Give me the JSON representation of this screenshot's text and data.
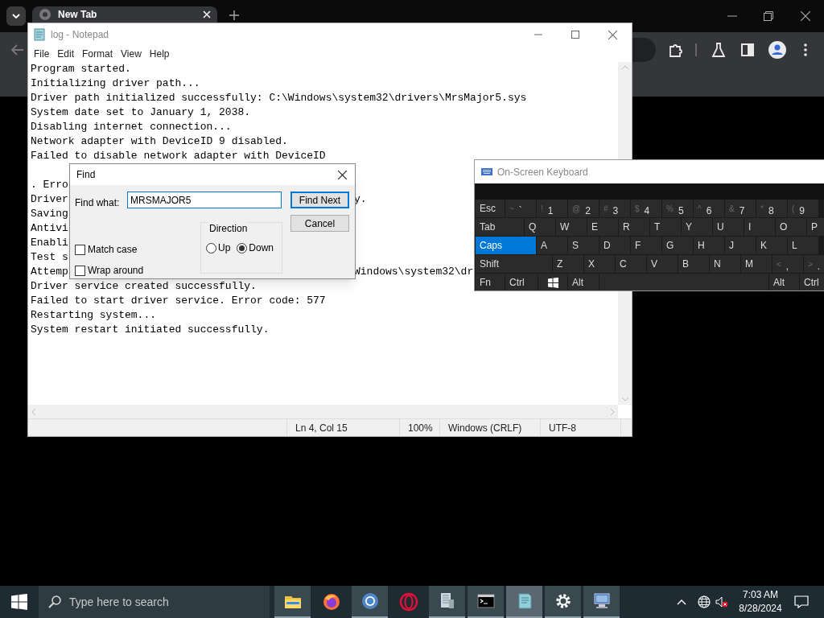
{
  "browser": {
    "tab": {
      "title": "New Tab",
      "selected": true
    }
  },
  "notepad": {
    "title": "log - Notepad",
    "menu": [
      "File",
      "Edit",
      "Format",
      "View",
      "Help"
    ],
    "lines": [
      {
        "text": "Program started."
      },
      {
        "text": "Initializing driver path..."
      },
      {
        "text": "Driver path initialized successfully: C:\\Windows\\system32\\drivers\\MrsMajor5.sys"
      },
      {
        "text": "System date set to January 1, 2038."
      },
      {
        "text": "Disabling internet connection..."
      },
      {
        "text": "Network adapter with DeviceID 9 disabled."
      },
      {
        "text": "Failed to disable network adapter with DeviceID"
      },
      {
        "left": ". Erro",
        "kind": "after_blank_line"
      },
      {
        "left": "Driver",
        "right": "y."
      },
      {
        "left": "Saving"
      },
      {
        "left": "Antivi"
      },
      {
        "left": "Enabli"
      },
      {
        "left": "Test s"
      },
      {
        "left": "Attemp",
        "right": "Windows\\system32\\dr"
      },
      {
        "text": "Driver service created successfully."
      },
      {
        "text": "Failed to start driver service. Error code: 577"
      },
      {
        "text": "Restarting system..."
      },
      {
        "text": "System restart initiated successfully."
      }
    ],
    "status_bar": [
      "Ln 4, Col 15",
      "100%",
      "Windows (CRLF)",
      "UTF-8"
    ]
  },
  "find_dialog": {
    "title": "Find",
    "label": "Find what:",
    "value": "MRSMAJOR5",
    "buttons": [
      {
        "label": "Find Next",
        "default": true
      },
      {
        "label": "Cancel",
        "default": false
      }
    ],
    "direction": {
      "label": "Direction",
      "options": [
        {
          "label": "Up",
          "selected": false
        },
        {
          "label": "Down",
          "selected": true
        }
      ]
    },
    "checkboxes": [
      {
        "label": "Match case",
        "checked": false
      },
      {
        "label": "Wrap around",
        "checked": false
      }
    ]
  },
  "keyboard": {
    "title": "On-Screen Keyboard",
    "rows": [
      [
        {
          "label": "Esc",
          "kind": "mod"
        },
        {
          "label": "`",
          "shift": "~",
          "kind": "key"
        },
        {
          "label": "1",
          "shift": "!",
          "kind": "key"
        },
        {
          "label": "2",
          "shift": "@",
          "kind": "key"
        },
        {
          "label": "3",
          "shift": "#",
          "kind": "key"
        },
        {
          "label": "4",
          "shift": "$",
          "kind": "key"
        },
        {
          "label": "5",
          "shift": "%",
          "kind": "key"
        },
        {
          "label": "6",
          "shift": "^",
          "kind": "key"
        },
        {
          "label": "7",
          "shift": "&",
          "kind": "key"
        },
        {
          "label": "8",
          "shift": "*",
          "kind": "key"
        },
        {
          "label": "9",
          "shift": "(",
          "kind": "key"
        }
      ],
      [
        {
          "label": "Tab",
          "kind": "mod"
        },
        {
          "label": "Q",
          "kind": "key"
        },
        {
          "label": "W",
          "kind": "key"
        },
        {
          "label": "E",
          "kind": "key"
        },
        {
          "label": "R",
          "kind": "key"
        },
        {
          "label": "T",
          "kind": "key"
        },
        {
          "label": "Y",
          "kind": "key"
        },
        {
          "label": "U",
          "kind": "key"
        },
        {
          "label": "I",
          "kind": "key"
        },
        {
          "label": "O",
          "kind": "key"
        },
        {
          "label": "P",
          "kind": "key"
        }
      ],
      [
        {
          "label": "Caps",
          "kind": "mod",
          "selected": true
        },
        {
          "label": "A",
          "kind": "key"
        },
        {
          "label": "S",
          "kind": "key"
        },
        {
          "label": "D",
          "kind": "key"
        },
        {
          "label": "F",
          "kind": "key"
        },
        {
          "label": "G",
          "kind": "key"
        },
        {
          "label": "H",
          "kind": "key"
        },
        {
          "label": "J",
          "kind": "key"
        },
        {
          "label": "K",
          "kind": "key"
        },
        {
          "label": "L",
          "kind": "key"
        }
      ],
      [
        {
          "label": "Shift",
          "kind": "mod"
        },
        {
          "label": "Z",
          "kind": "key"
        },
        {
          "label": "X",
          "kind": "key"
        },
        {
          "label": "C",
          "kind": "key"
        },
        {
          "label": "V",
          "kind": "key"
        },
        {
          "label": "B",
          "kind": "key"
        },
        {
          "label": "N",
          "kind": "key"
        },
        {
          "label": "M",
          "kind": "key"
        },
        {
          "label": ",",
          "shift": "<",
          "kind": "key"
        },
        {
          "label": ".",
          "shift": ">",
          "kind": "key"
        }
      ],
      [
        {
          "label": "Fn",
          "kind": "key"
        },
        {
          "label": "Ctrl",
          "kind": "key"
        },
        {
          "kind": "windows"
        },
        {
          "label": "Alt",
          "kind": "key"
        },
        {
          "kind": "space"
        },
        {
          "label": "Alt",
          "kind": "key"
        },
        {
          "label": "Ctrl",
          "kind": "key"
        }
      ]
    ]
  },
  "taskbar": {
    "search_placeholder": "Type here to search",
    "apps": [
      {
        "kind": "folder",
        "running": true,
        "active": false
      },
      {
        "kind": "firefox",
        "running": false,
        "active": false
      },
      {
        "kind": "chrome",
        "running": true,
        "active": false
      },
      {
        "kind": "opera",
        "running": false,
        "active": false
      },
      {
        "kind": "document",
        "running": true,
        "active": false
      },
      {
        "kind": "terminal",
        "running": true,
        "active": false
      },
      {
        "kind": "notepad",
        "running": true,
        "active": true
      },
      {
        "kind": "settings",
        "running": true,
        "active": false
      },
      {
        "kind": "remote",
        "running": true,
        "active": false
      }
    ],
    "time": "7:03 AM",
    "date": "8/28/2024"
  }
}
